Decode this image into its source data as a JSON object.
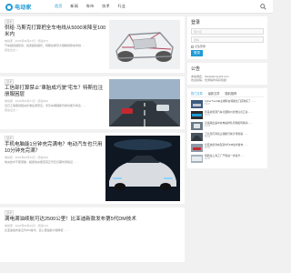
{
  "site": {
    "logo_text": "电动家",
    "brand_color": "#1f9ad6"
  },
  "nav": {
    "items": [
      "首页",
      "新闻",
      "车市",
      "技术",
      "行业"
    ],
    "active_index": 0
  },
  "posts": [
    {
      "category": "技术",
      "title": "供给·马斯克打算把全车电线从5000米降至100米内",
      "meta": "电动家 · 2024年06月27日 · 阅读(97)",
      "excerpt": "汽车越来越复杂，线束越来越长，特斯拉希望大幅精简整车布线……",
      "more": "阅读全文 >"
    },
    {
      "category": "技术",
      "title": "工信部打算禁止“車胎成巧驶”宅车？特斯拉注册服困层",
      "meta": "电动家 · 2024年06月27日 · 阅读(85)",
      "excerpt": "近日工信部就相关标准征求意见，涉及车辆辅助驾驶功能与命名……",
      "more": "阅读全文 >"
    },
    {
      "category": "技术",
      "title": "手机电脑能1分钟充完满电？电动汽车也只用10分钟充完满？",
      "meta": "电动家 · 2024年06月26日 · 阅读(66)",
      "excerpt": "快充技术不断突破，超级快充能否真正普及仍需时间验证……",
      "more": ""
    },
    {
      "category": "技术",
      "title": "满电满油续航可达2500公里！比亚迪新款发布第5代DM技术",
      "meta": "电动家 · 2024年06月26日 · 阅读(72)",
      "excerpt": "比亚迪发布第五代DM技术，百公里油耗大幅降低……",
      "more": ""
    }
  ],
  "sidebar": {
    "login": {
      "title": "登录",
      "username_placeholder": "用户名",
      "password_placeholder": "密码",
      "remember_label": "记住登录",
      "submit_label": "登录"
    },
    "notice": {
      "title": "公告",
      "lines": [
        "本站域名：dianjiadong123.com",
        "欢迎投稿，优秀稿件将获奖励"
      ]
    },
    "tabs": [
      "热门文章",
      "最新文章",
      "随机推荐"
    ],
    "articles": [
      {
        "title": "CyberTruck车主爆料在特斯拉门店购买了……",
        "date": "06-27"
      },
      {
        "title": "蔚来新能源汽车全面降价优惠信息汇总……",
        "date": "06-27"
      },
      {
        "title": "高速路出差中充电站排队问题如何解决……",
        "date": "06-26"
      },
      {
        "title": "工信部打算禁止辅助驾驶宣传用语……",
        "date": "06-26"
      },
      {
        "title": "比亚迪新款车型第5代DM技术发布……",
        "date": "06-26"
      },
      {
        "title": "特斯拉上海工厂产能进一步提升……",
        "date": "06-25"
      }
    ]
  }
}
